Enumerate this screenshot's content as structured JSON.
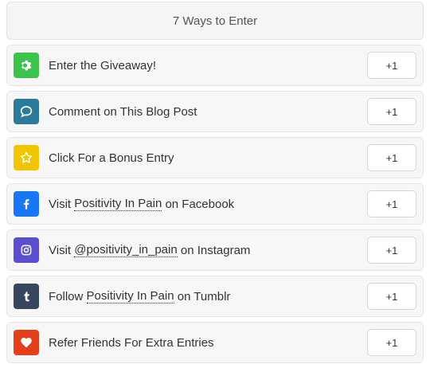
{
  "header": {
    "title": "7 Ways to Enter"
  },
  "entries": [
    {
      "pre": "Enter the Giveaway!",
      "link": "",
      "post": "",
      "points": "+1",
      "icon": "gear-icon",
      "color": "#3cc34b"
    },
    {
      "pre": "Comment on This Blog Post",
      "link": "",
      "post": "",
      "points": "+1",
      "icon": "speech-bubble-icon",
      "color": "#2b7a9a"
    },
    {
      "pre": "Click For a Bonus Entry",
      "link": "",
      "post": "",
      "points": "+1",
      "icon": "star-icon",
      "color": "#f2c500"
    },
    {
      "pre": "Visit ",
      "link": "Positivity In Pain",
      "post": " on Facebook",
      "points": "+1",
      "icon": "facebook-icon",
      "color": "#1877f2"
    },
    {
      "pre": "Visit ",
      "link": "@positivity_in_pain",
      "post": " on Instagram",
      "points": "+1",
      "icon": "instagram-icon",
      "color": "#5c4fcf"
    },
    {
      "pre": "Follow ",
      "link": "Positivity In Pain",
      "post": " on Tumblr",
      "points": "+1",
      "icon": "tumblr-icon",
      "color": "#36465d"
    },
    {
      "pre": "Refer Friends For Extra Entries",
      "link": "",
      "post": "",
      "points": "+1",
      "icon": "heart-icon",
      "color": "#e2401c"
    }
  ]
}
